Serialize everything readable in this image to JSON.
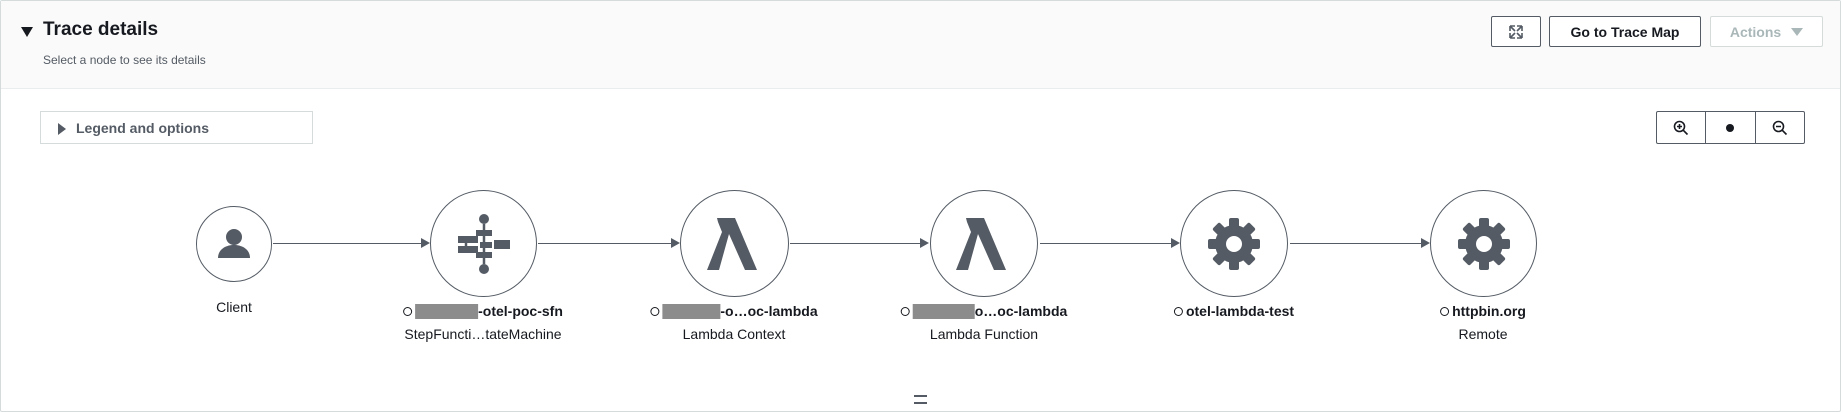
{
  "header": {
    "title": "Trace details",
    "subtitle": "Select a node to see its details",
    "fullscreen_icon": "expand-icon",
    "trace_map_label": "Go to Trace Map",
    "actions_label": "Actions"
  },
  "legend": {
    "label": "Legend and options"
  },
  "zoom": {
    "zoom_in_icon": "zoom-in-icon",
    "reset_icon": "reset-dot-icon",
    "zoom_out_icon": "zoom-out-icon"
  },
  "nodes": [
    {
      "icon": "user-icon",
      "name": "Client",
      "type": ""
    },
    {
      "icon": "step-functions-icon",
      "name_suffix": "-otel-poc-sfn",
      "type": "StepFuncti…tateMachine",
      "redacted": true
    },
    {
      "icon": "lambda-icon",
      "name_suffix": "-o…oc-lambda",
      "type": "Lambda Context",
      "redacted": true
    },
    {
      "icon": "lambda-icon",
      "name_suffix": "o…oc-lambda",
      "type": "Lambda Function",
      "redacted": true
    },
    {
      "icon": "gear-icon",
      "name": "otel-lambda-test",
      "type": ""
    },
    {
      "icon": "gear-icon",
      "name": "httpbin.org",
      "type": "Remote"
    }
  ],
  "colors": {
    "icon": "#545b64",
    "border": "#545b64",
    "header_bg": "#fafafa",
    "redaction": "#8c8c8c"
  }
}
